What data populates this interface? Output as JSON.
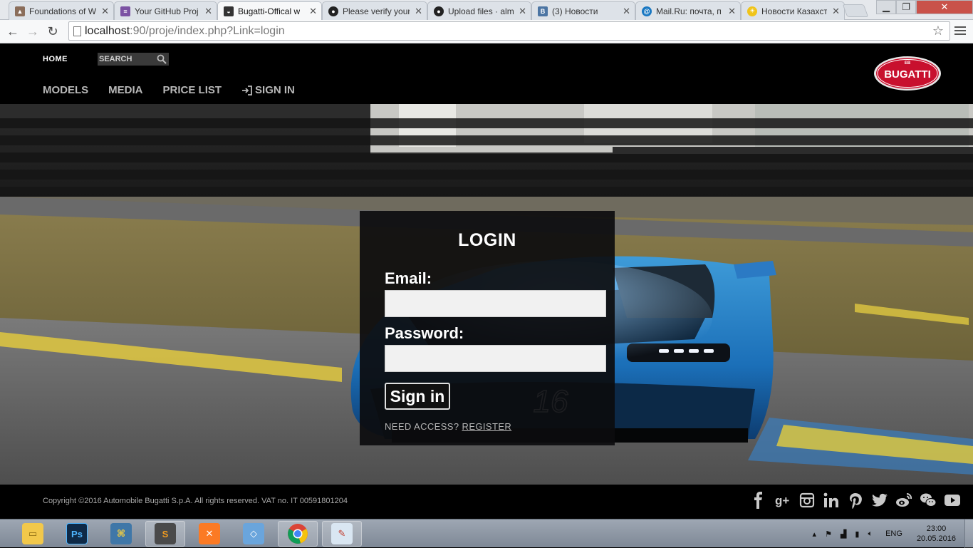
{
  "browser": {
    "tabs": [
      {
        "title": "Foundations of W",
        "icon": "person-icon",
        "color": "#8a6d5a",
        "active": false
      },
      {
        "title": "Your GitHub Proj",
        "icon": "form-icon",
        "color": "#7b52a3",
        "active": false
      },
      {
        "title": "Bugatti-Offical w",
        "icon": "car-icon",
        "color": "#333333",
        "active": true
      },
      {
        "title": "Please verify your",
        "icon": "github-icon",
        "color": "#222222",
        "active": false
      },
      {
        "title": "Upload files · alm",
        "icon": "github-icon",
        "color": "#222222",
        "active": false
      },
      {
        "title": "(3) Новости",
        "icon": "vk-icon",
        "color": "#4c75a3",
        "active": false
      },
      {
        "title": "Mail.Ru: почта, п",
        "icon": "mailru-icon",
        "color": "#1a78c2",
        "active": false
      },
      {
        "title": "Новости Казахст",
        "icon": "sun-icon",
        "color": "#f0c419",
        "active": false
      }
    ],
    "url_host": "localhost",
    "url_path": ":90/proje/index.php?Link=login"
  },
  "site": {
    "home_label": "HOME",
    "search_placeholder": "SEARCH",
    "nav": [
      "MODELS",
      "MEDIA",
      "PRICE LIST",
      "SIGN IN"
    ],
    "logo_text": "BUGATTI",
    "brand_red": "#c8102e"
  },
  "login": {
    "title": "LOGIN",
    "email_label": "Email:",
    "email_value": "",
    "password_label": "Password:",
    "password_value": "",
    "submit_label": "Sign in",
    "access_text": "NEED ACCESS?",
    "register_label": "REGISTER"
  },
  "hero": {
    "car_number": "16"
  },
  "footer": {
    "copyright": "Copyright ©2016 Automobile Bugatti S.p.A. All rights reserved. VAT no. IT 00591801204",
    "social": [
      "facebook-icon",
      "google-plus-icon",
      "instagram-icon",
      "linkedin-icon",
      "pinterest-icon",
      "twitter-icon",
      "weibo-icon",
      "wechat-icon",
      "youtube-icon"
    ]
  },
  "taskbar": {
    "apps": [
      "explorer-icon",
      "photoshop-icon",
      "python-icon",
      "sublime-icon",
      "xampp-icon",
      "virtualbox-icon",
      "chrome-icon",
      "paint-icon"
    ],
    "photoshop_label": "Ps",
    "sublime_label": "S",
    "language": "ENG",
    "time": "23:00",
    "date": "20.05.2016"
  }
}
